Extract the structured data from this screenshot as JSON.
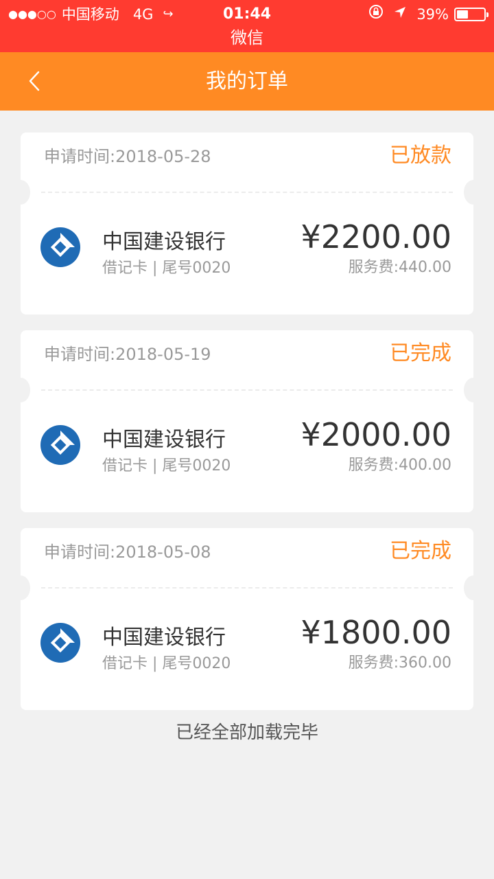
{
  "status_bar": {
    "signal": "●●●○○",
    "carrier": "中国移动",
    "network": "4G",
    "time": "01:44",
    "battery": "39%",
    "battery_level": 0.39,
    "app_name": "微信"
  },
  "nav": {
    "title": "我的订单"
  },
  "orders": [
    {
      "apply_time": "申请时间:2018-05-28",
      "status": "已放款",
      "bank_name": "中国建设银行",
      "card_info": "借记卡 | 尾号0020",
      "amount": "¥2200.00",
      "fee": "服务费:440.00"
    },
    {
      "apply_time": "申请时间:2018-05-19",
      "status": "已完成",
      "bank_name": "中国建设银行",
      "card_info": "借记卡 | 尾号0020",
      "amount": "¥2000.00",
      "fee": "服务费:400.00"
    },
    {
      "apply_time": "申请时间:2018-05-08",
      "status": "已完成",
      "bank_name": "中国建设银行",
      "card_info": "借记卡 | 尾号0020",
      "amount": "¥1800.00",
      "fee": "服务费:360.00"
    }
  ],
  "footer": {
    "loaded_text": "已经全部加载完毕"
  },
  "colors": {
    "status_bar_bg": "#ff3b30",
    "nav_bg": "#ff8a23",
    "accent": "#ff8a23",
    "bank_blue": "#1f6bb5"
  },
  "icons": {
    "back": "chevron-left-icon",
    "bank": "ccb-bank-logo-icon"
  }
}
